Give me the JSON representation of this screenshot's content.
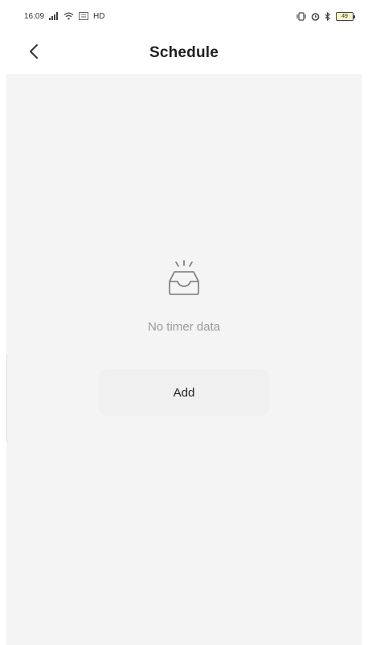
{
  "status_bar": {
    "time": "16:09",
    "network": "HD",
    "battery": "49"
  },
  "header": {
    "title": "Schedule"
  },
  "empty_state": {
    "message": "No timer data",
    "add_label": "Add"
  },
  "icons": {
    "back": "chevron-left-icon",
    "empty": "inbox-icon"
  },
  "colors": {
    "background": "#f4f4f4",
    "text_primary": "#1f1f1f",
    "text_muted": "#9a9a9a",
    "button_bg": "#f0f0f0"
  }
}
